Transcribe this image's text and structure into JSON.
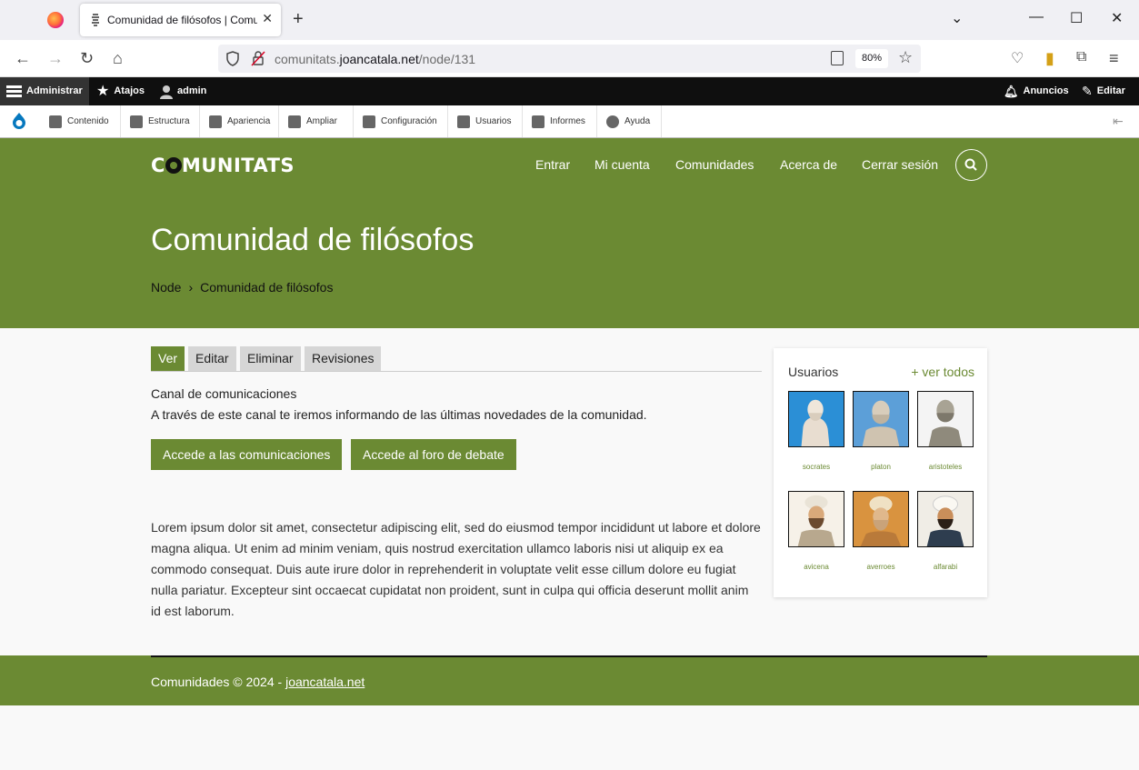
{
  "browser": {
    "tab_title": "Comunidad de filósofos | Comunitats",
    "url_host_pre": "comunitats.",
    "url_host_main": "joancatala.net",
    "url_path": "/node/131",
    "zoom": "80%"
  },
  "admin_toolbar": {
    "admin": "Administrar",
    "shortcuts": "Atajos",
    "user": "admin",
    "announcements": "Anuncios",
    "edit": "Editar",
    "tray": [
      "Contenido",
      "Estructura",
      "Apariencia",
      "Ampliar",
      "Configuración",
      "Usuarios",
      "Informes",
      "Ayuda"
    ]
  },
  "site": {
    "logo_pre": "C",
    "logo_post": "MUNITATS",
    "menu": [
      "Entrar",
      "Mi cuenta",
      "Comunidades",
      "Acerca de",
      "Cerrar sesión"
    ],
    "page_title": "Comunidad de filósofos",
    "breadcrumb": [
      "Node",
      "Comunidad de filósofos"
    ]
  },
  "local_tabs": [
    "Ver",
    "Editar",
    "Eliminar",
    "Revisiones"
  ],
  "content": {
    "heading": "Canal de comunicaciones",
    "intro": "A través de este canal te iremos informando de las últimas novedades de la comunidad.",
    "btn_comms": "Accede a las comunicaciones",
    "btn_forum": "Accede al foro de debate",
    "lorem": "Lorem ipsum dolor sit amet, consectetur adipiscing elit, sed do eiusmod tempor incididunt ut labore et dolore magna aliqua. Ut enim ad minim veniam, quis nostrud exercitation ullamco laboris nisi ut aliquip ex ea commodo consequat. Duis aute irure dolor in reprehenderit in voluptate velit esse cillum dolore eu fugiat nulla pariatur. Excepteur sint occaecat cupidatat non proident, sunt in culpa qui officia deserunt mollit anim id est laborum."
  },
  "users_block": {
    "title": "Usuarios",
    "see_all": "+ ver todos",
    "users": [
      "socrates",
      "platon",
      "aristoteles",
      "avicena",
      "averroes",
      "alfarabi"
    ]
  },
  "footer": {
    "text": "Comunidades © 2024 - ",
    "link": "joancatala.net"
  },
  "colors": {
    "brand_green": "#6b8a33",
    "admin_bar": "#0f0f0f"
  }
}
